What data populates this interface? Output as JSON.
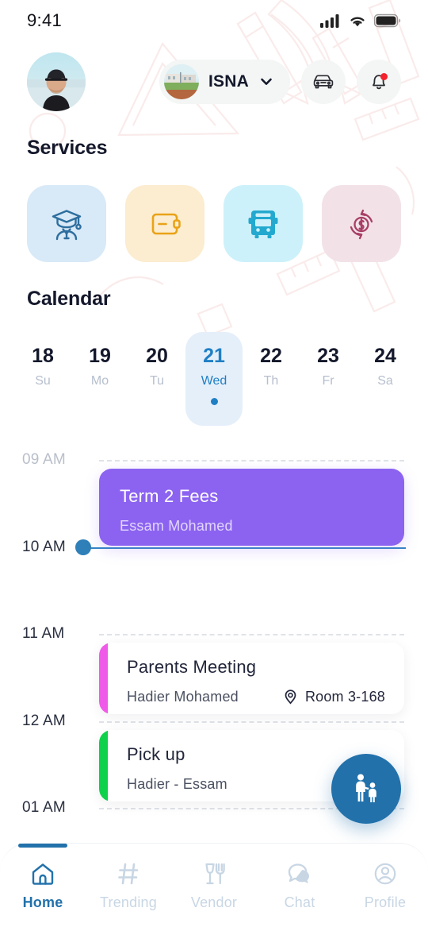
{
  "status_bar": {
    "time": "9:41",
    "icons": [
      "cellular-signal-icon",
      "wifi-icon",
      "battery-icon"
    ]
  },
  "header": {
    "avatar_name": "user-avatar",
    "school": {
      "name": "ISNA",
      "thumb_name": "school-thumbnail",
      "chevron": "chevron-down-icon"
    },
    "car_button_icon": "car-icon",
    "bell_button_icon": "bell-icon",
    "bell_has_badge": true
  },
  "services": {
    "title": "Services",
    "items": [
      {
        "name": "student",
        "icon": "graduate-student-icon",
        "bg": "#d8e9f7",
        "fg": "#2d6e9e"
      },
      {
        "name": "wallet",
        "icon": "wallet-icon",
        "bg": "#fcecd0",
        "fg": "#e9a318"
      },
      {
        "name": "bus",
        "icon": "bus-icon",
        "bg": "#cdf1fa",
        "fg": "#23a9cf"
      },
      {
        "name": "refund",
        "icon": "refund-cycle-icon",
        "bg": "#f2e2e7",
        "fg": "#a83f66"
      }
    ]
  },
  "calendar": {
    "title": "Calendar",
    "days": [
      {
        "num": "18",
        "dow": "Su",
        "active": false
      },
      {
        "num": "19",
        "dow": "Mo",
        "active": false
      },
      {
        "num": "20",
        "dow": "Tu",
        "active": false
      },
      {
        "num": "21",
        "dow": "Wed",
        "active": true
      },
      {
        "num": "22",
        "dow": "Th",
        "active": false
      },
      {
        "num": "23",
        "dow": "Fr",
        "active": false
      },
      {
        "num": "24",
        "dow": "Sa",
        "active": false
      }
    ]
  },
  "agenda": {
    "time_slots": [
      "09 AM",
      "10 AM",
      "11 AM",
      "12 AM",
      "01 AM"
    ],
    "current_time_marker": "10 AM",
    "events": [
      {
        "title": "Term 2 Fees",
        "subtitle": "Essam Mohamed",
        "style": "filled",
        "color": "#8c63f0",
        "location": null
      },
      {
        "title": "Parents Meeting",
        "subtitle": "Hadier Mohamed",
        "style": "outlined",
        "color": "#ef5ae8",
        "location": "Room 3-168",
        "location_icon": "location-pin-icon"
      },
      {
        "title": "Pick up",
        "subtitle": "Hadier - Essam",
        "style": "outlined",
        "color": "#10d14b",
        "location": null
      }
    ]
  },
  "fab": {
    "icon": "parent-child-icon",
    "color": "#2271ab"
  },
  "bottom_nav": {
    "items": [
      {
        "label": "Home",
        "icon": "home-icon",
        "active": true
      },
      {
        "label": "Trending",
        "icon": "hash-icon",
        "active": false
      },
      {
        "label": "Vendor",
        "icon": "cutlery-icon",
        "active": false
      },
      {
        "label": "Chat",
        "icon": "chat-bubble-icon",
        "active": false
      },
      {
        "label": "Profile",
        "icon": "user-circle-icon",
        "active": false
      }
    ],
    "active_color": "#2271ab",
    "inactive_color": "#c8d6e4"
  }
}
